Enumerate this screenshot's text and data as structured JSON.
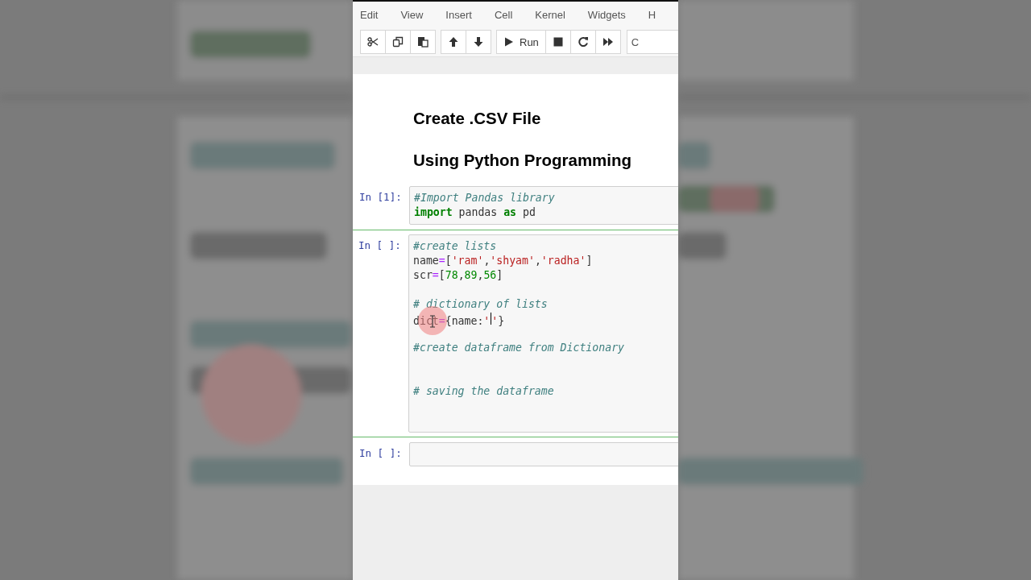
{
  "menu": [
    {
      "label": "Edit"
    },
    {
      "label": "View"
    },
    {
      "label": "Insert"
    },
    {
      "label": "Cell"
    },
    {
      "label": "Kernel"
    },
    {
      "label": "Widgets"
    },
    {
      "label": "H"
    }
  ],
  "toolbar": {
    "groups": [
      [
        {
          "kind": "cut"
        },
        {
          "kind": "copy"
        },
        {
          "kind": "paste"
        }
      ],
      [
        {
          "kind": "up"
        },
        {
          "kind": "down"
        }
      ],
      [
        {
          "kind": "run",
          "label": "Run"
        },
        {
          "kind": "stop"
        },
        {
          "kind": "restart"
        },
        {
          "kind": "fastforward"
        }
      ]
    ],
    "cell_type": "C"
  },
  "cells": [
    {
      "kind": "markdown",
      "headings": [
        "Create .CSV File",
        "Using Python Programming"
      ]
    },
    {
      "kind": "code",
      "prompt": "In [1]:",
      "selected": false,
      "lines": [
        {
          "kind": "code",
          "tokens": [
            {
              "kind": "comment",
              "text": "#Import Pandas library"
            }
          ]
        },
        {
          "kind": "code",
          "tokens": [
            {
              "kind": "keyword",
              "text": "import"
            },
            {
              "kind": "plain",
              "text": " pandas "
            },
            {
              "kind": "keyword",
              "text": "as"
            },
            {
              "kind": "plain",
              "text": " pd"
            }
          ]
        }
      ]
    },
    {
      "kind": "code",
      "prompt": "In [ ]:",
      "selected": true,
      "lines": [
        {
          "kind": "code",
          "tokens": [
            {
              "kind": "comment",
              "text": "#create lists"
            }
          ]
        },
        {
          "kind": "code",
          "tokens": [
            {
              "kind": "plain",
              "text": "name"
            },
            {
              "kind": "operator",
              "text": "="
            },
            {
              "kind": "plain",
              "text": "["
            },
            {
              "kind": "string",
              "text": "'ram'"
            },
            {
              "kind": "plain",
              "text": ","
            },
            {
              "kind": "string",
              "text": "'shyam'"
            },
            {
              "kind": "plain",
              "text": ","
            },
            {
              "kind": "string",
              "text": "'radha'"
            },
            {
              "kind": "plain",
              "text": "]"
            }
          ]
        },
        {
          "kind": "code",
          "tokens": [
            {
              "kind": "plain",
              "text": "scr"
            },
            {
              "kind": "operator",
              "text": "="
            },
            {
              "kind": "plain",
              "text": "["
            },
            {
              "kind": "number",
              "text": "78"
            },
            {
              "kind": "plain",
              "text": ","
            },
            {
              "kind": "number",
              "text": "89"
            },
            {
              "kind": "plain",
              "text": ","
            },
            {
              "kind": "number",
              "text": "56"
            },
            {
              "kind": "plain",
              "text": "]"
            }
          ]
        },
        {
          "kind": "blank"
        },
        {
          "kind": "code",
          "tokens": [
            {
              "kind": "comment",
              "text": "# dictionary of lists"
            }
          ]
        },
        {
          "kind": "code",
          "tokens": [
            {
              "kind": "plain",
              "text": "dict"
            },
            {
              "kind": "operator",
              "text": "="
            },
            {
              "kind": "plain",
              "text": "{name:"
            },
            {
              "kind": "string",
              "text": "'"
            },
            {
              "kind": "caret"
            },
            {
              "kind": "string",
              "text": "'"
            },
            {
              "kind": "plain",
              "text": "}"
            }
          ]
        },
        {
          "kind": "blank"
        },
        {
          "kind": "code",
          "tokens": [
            {
              "kind": "comment",
              "text": "#create dataframe from Dictionary"
            }
          ]
        },
        {
          "kind": "blank"
        },
        {
          "kind": "blank"
        },
        {
          "kind": "code",
          "tokens": [
            {
              "kind": "comment",
              "text": "# saving the dataframe"
            }
          ]
        },
        {
          "kind": "blank"
        },
        {
          "kind": "blank"
        }
      ]
    },
    {
      "kind": "code",
      "prompt": "In [ ]:",
      "selected": false,
      "lines": [
        {
          "kind": "blank"
        }
      ]
    }
  ]
}
